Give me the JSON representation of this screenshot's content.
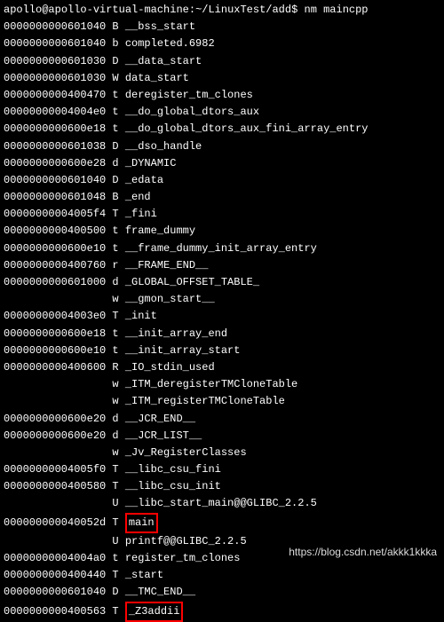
{
  "prompt": {
    "user": "apollo",
    "host": "apollo-virtual-machine",
    "path": "~/LinuxTest/add",
    "command": "nm maincpp"
  },
  "rows": [
    {
      "addr": "0000000000601040",
      "type": "B",
      "sym": "__bss_start"
    },
    {
      "addr": "0000000000601040",
      "type": "b",
      "sym": "completed.6982"
    },
    {
      "addr": "0000000000601030",
      "type": "D",
      "sym": "__data_start"
    },
    {
      "addr": "0000000000601030",
      "type": "W",
      "sym": "data_start"
    },
    {
      "addr": "0000000000400470",
      "type": "t",
      "sym": "deregister_tm_clones"
    },
    {
      "addr": "00000000004004e0",
      "type": "t",
      "sym": "__do_global_dtors_aux"
    },
    {
      "addr": "0000000000600e18",
      "type": "t",
      "sym": "__do_global_dtors_aux_fini_array_entry"
    },
    {
      "addr": "0000000000601038",
      "type": "D",
      "sym": "__dso_handle"
    },
    {
      "addr": "0000000000600e28",
      "type": "d",
      "sym": "_DYNAMIC"
    },
    {
      "addr": "0000000000601040",
      "type": "D",
      "sym": "_edata"
    },
    {
      "addr": "0000000000601048",
      "type": "B",
      "sym": "_end"
    },
    {
      "addr": "00000000004005f4",
      "type": "T",
      "sym": "_fini"
    },
    {
      "addr": "0000000000400500",
      "type": "t",
      "sym": "frame_dummy"
    },
    {
      "addr": "0000000000600e10",
      "type": "t",
      "sym": "__frame_dummy_init_array_entry"
    },
    {
      "addr": "0000000000400760",
      "type": "r",
      "sym": "__FRAME_END__"
    },
    {
      "addr": "0000000000601000",
      "type": "d",
      "sym": "_GLOBAL_OFFSET_TABLE_"
    },
    {
      "addr": "                ",
      "type": "w",
      "sym": "__gmon_start__"
    },
    {
      "addr": "00000000004003e0",
      "type": "T",
      "sym": "_init"
    },
    {
      "addr": "0000000000600e18",
      "type": "t",
      "sym": "__init_array_end"
    },
    {
      "addr": "0000000000600e10",
      "type": "t",
      "sym": "__init_array_start"
    },
    {
      "addr": "0000000000400600",
      "type": "R",
      "sym": "_IO_stdin_used"
    },
    {
      "addr": "                ",
      "type": "w",
      "sym": "_ITM_deregisterTMCloneTable"
    },
    {
      "addr": "                ",
      "type": "w",
      "sym": "_ITM_registerTMCloneTable"
    },
    {
      "addr": "0000000000600e20",
      "type": "d",
      "sym": "__JCR_END__"
    },
    {
      "addr": "0000000000600e20",
      "type": "d",
      "sym": "__JCR_LIST__"
    },
    {
      "addr": "                ",
      "type": "w",
      "sym": "_Jv_RegisterClasses"
    },
    {
      "addr": "00000000004005f0",
      "type": "T",
      "sym": "__libc_csu_fini"
    },
    {
      "addr": "0000000000400580",
      "type": "T",
      "sym": "__libc_csu_init"
    },
    {
      "addr": "                ",
      "type": "U",
      "sym": "__libc_start_main@@GLIBC_2.2.5"
    },
    {
      "addr": "000000000040052d",
      "type": "T",
      "sym": "main",
      "hl": true
    },
    {
      "addr": "                ",
      "type": "U",
      "sym": "printf@@GLIBC_2.2.5"
    },
    {
      "addr": "00000000004004a0",
      "type": "t",
      "sym": "register_tm_clones"
    },
    {
      "addr": "0000000000400440",
      "type": "T",
      "sym": "_start"
    },
    {
      "addr": "0000000000601040",
      "type": "D",
      "sym": "__TMC_END__"
    },
    {
      "addr": "0000000000400563",
      "type": "T",
      "sym": "_Z3addii",
      "hl": true
    }
  ],
  "watermark": "https://blog.csdn.net/akkk1kkka"
}
